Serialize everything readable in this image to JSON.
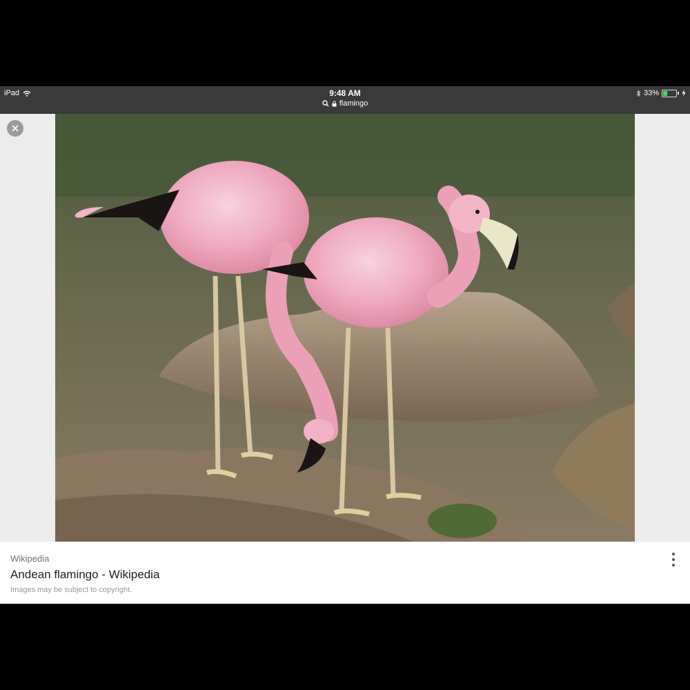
{
  "status_bar": {
    "device": "iPad",
    "time": "9:48 AM",
    "url": "flamingo",
    "battery": "33%",
    "battery_level": 0.33,
    "icons": [
      "wifi-icon",
      "search-icon",
      "lock-icon",
      "bluetooth-icon",
      "battery-icon",
      "charging-icon"
    ]
  },
  "viewer": {
    "close_icon": "close-icon",
    "image_subject": "two Andean flamingos standing at water's edge"
  },
  "result": {
    "source": "Wikipedia",
    "title": "Andean flamingo - Wikipedia",
    "copyright": "Images may be subject to copyright.",
    "menu_icon": "more-vertical-icon"
  },
  "colors": {
    "status_bg": "#3a3a3a",
    "viewer_bg": "#ececec",
    "battery_green": "#4cd964"
  }
}
